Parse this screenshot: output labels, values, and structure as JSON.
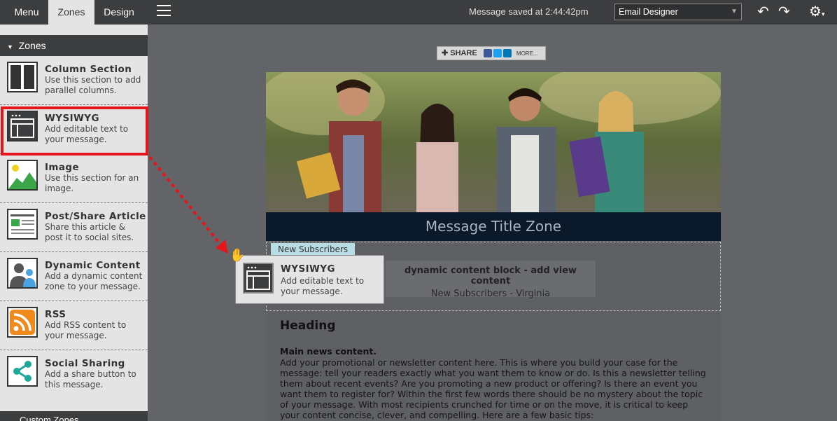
{
  "topbar": {
    "tabs": [
      "Menu",
      "Zones",
      "Design"
    ],
    "saved": "Message saved at 2:44:42pm",
    "select_value": "Email Designer"
  },
  "sidebar": {
    "header": "Zones",
    "items": [
      {
        "title": "Column Section",
        "desc": "Use this section to add parallel columns."
      },
      {
        "title": "WYSIWYG",
        "desc": "Add editable text to your message."
      },
      {
        "title": "Image",
        "desc": "Use this section for an image."
      },
      {
        "title": "Post/Share Article",
        "desc": "Share this article & post it to social sites."
      },
      {
        "title": "Dynamic Content",
        "desc": "Add a dynamic content zone to your message."
      },
      {
        "title": "RSS",
        "desc": "Add RSS content to your message."
      },
      {
        "title": "Social Sharing",
        "desc": "Add a share button to this message."
      }
    ],
    "footer": "Custom Zones"
  },
  "share": {
    "label": "SHARE",
    "more": "MORE..."
  },
  "email": {
    "title": "Message Title Zone",
    "subscribers_tag": "New Subscribers",
    "dyn_line1": "dynamic content block - add view content",
    "dyn_line2": "New Subscribers - Virginia",
    "heading": "Heading",
    "body_title": "Main news content.",
    "body_text": "Add your promotional or newsletter content here. This is where you build your case for the message: tell your readers exactly what you want them to know or do. Is this a newsletter telling them about recent events? Are you promoting a new product or offering? Is there an event you want them to register for? Within the first few words there should be no mystery about the topic of your message. With most recipients crunched for time or on the move, it is critical to keep your content concise, clever, and compelling. Here are a few basic tips:"
  },
  "ghost": {
    "title": "WYSIWYG",
    "desc": "Add editable text to your message."
  },
  "colors": {
    "highlight": "#e8141b",
    "topbar": "#3c3d3f",
    "title_zone": "#0b1a2a"
  }
}
